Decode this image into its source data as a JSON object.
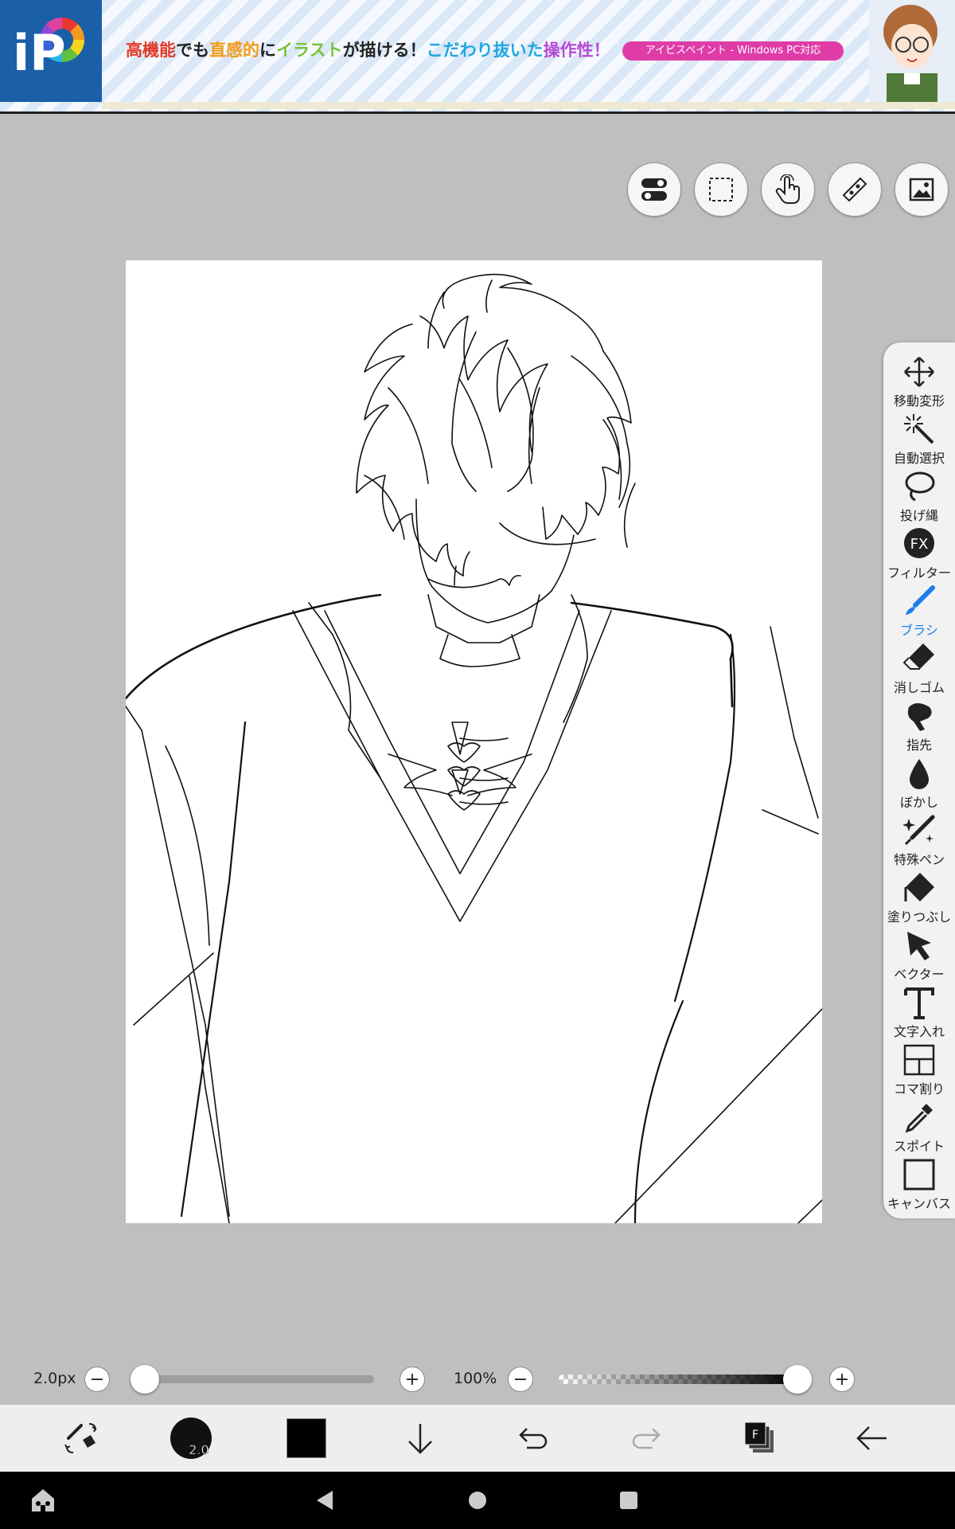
{
  "ad": {
    "logo_text": "iP",
    "headline_parts": [
      "高機能",
      "でも",
      "直感的",
      "に",
      "イラスト",
      "が描ける！",
      "こだわり抜いた",
      "操作性！"
    ],
    "badge": "アイビスペイント - Windows PC対応"
  },
  "top_toolbar": {
    "icons": [
      "toggle-icon",
      "selection-icon",
      "touch-icon",
      "ruler-icon",
      "image-icon"
    ]
  },
  "tools": [
    {
      "label": "移動変形",
      "icon": "move-icon"
    },
    {
      "label": "自動選択",
      "icon": "magic-wand-icon"
    },
    {
      "label": "投げ縄",
      "icon": "lasso-icon"
    },
    {
      "label": "フィルター",
      "icon": "fx-icon"
    },
    {
      "label": "ブラシ",
      "icon": "brush-icon",
      "active": true
    },
    {
      "label": "消しゴム",
      "icon": "eraser-icon"
    },
    {
      "label": "指先",
      "icon": "finger-icon"
    },
    {
      "label": "ぼかし",
      "icon": "blur-icon"
    },
    {
      "label": "特殊ペン",
      "icon": "special-pen-icon"
    },
    {
      "label": "塗りつぶし",
      "icon": "fill-icon"
    },
    {
      "label": "ベクター",
      "icon": "vector-icon"
    },
    {
      "label": "文字入れ",
      "icon": "text-icon"
    },
    {
      "label": "コマ割り",
      "icon": "frame-divider-icon"
    },
    {
      "label": "スポイト",
      "icon": "eyedropper-icon"
    },
    {
      "label": "キャンバス",
      "icon": "canvas-icon"
    }
  ],
  "brush_controls": {
    "size_label": "2.0px",
    "size_slider_value": 0.02,
    "opacity_label": "100%",
    "opacity_slider_value": 1.0,
    "minus": "−",
    "plus": "+"
  },
  "bottom_bar": {
    "brush_size_text": "2.0",
    "color": "#000000",
    "layer_badge": "F",
    "icons": [
      "brush-eraser-swap-icon",
      "brush-size-icon",
      "color-swatch",
      "download-icon",
      "undo-icon",
      "redo-icon",
      "layers-icon",
      "back-icon"
    ]
  },
  "colors": {
    "accent": "#1e7cf0",
    "background": "#bfbfbf",
    "canvas": "#ffffff"
  }
}
